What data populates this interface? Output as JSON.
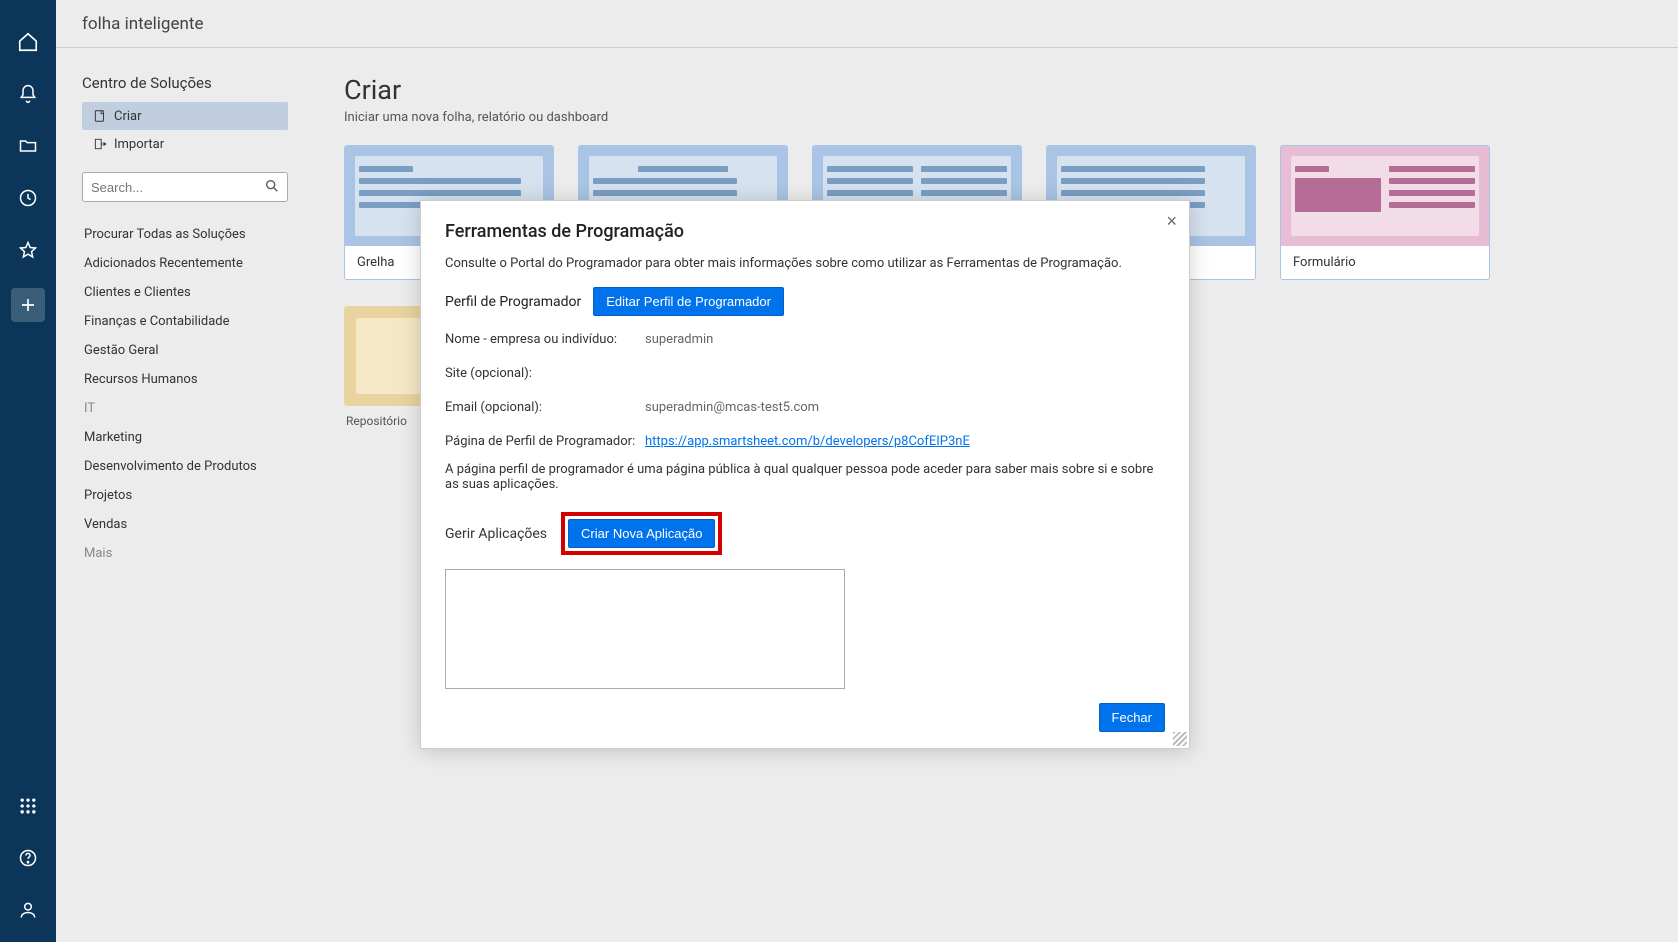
{
  "header": {
    "app_name": "folha inteligente"
  },
  "sidebar": {
    "title": "Centro de Soluções",
    "create": "Criar",
    "import": "Importar",
    "search_placeholder": "Search...",
    "links": [
      "Procurar Todas as Soluções",
      "Adicionados Recentemente",
      "Clientes e Clientes",
      "Finanças e Contabilidade",
      "Gestão Geral",
      "Recursos Humanos",
      "IT",
      "Marketing",
      "Desenvolvimento de Produtos",
      "Projetos",
      "Vendas",
      "Mais"
    ]
  },
  "main": {
    "title": "Criar",
    "subtitle": "Iniciar uma nova folha, relatório ou dashboard",
    "cards": {
      "grid": "Grelha",
      "form": "Formulário",
      "repo": "Repositório"
    }
  },
  "modal": {
    "title": "Ferramentas de Programação",
    "intro": "Consulte o Portal do Programador para obter mais informações sobre como utilizar as Ferramentas de Programação.",
    "profile_section": "Perfil de Programador",
    "edit_profile_btn": "Editar Perfil de Programador",
    "name_label": "Nome - empresa ou indivíduo:",
    "name_value": "superadmin",
    "site_label": "Site (opcional):",
    "site_value": "",
    "email_label": "Email (opcional):",
    "email_value": "superadmin@mcas-test5.com",
    "page_label": "Página de Perfil de Programador:",
    "page_link": "https://app.smartsheet.com/b/developers/p8CofEIP3nE",
    "note": "A página perfil de programador é uma página pública à qual qualquer pessoa pode aceder para saber mais sobre si e sobre as suas aplicações.",
    "manage_label": "Gerir Aplicações",
    "create_app_btn": "Criar Nova Aplicação",
    "close_btn": "Fechar"
  }
}
